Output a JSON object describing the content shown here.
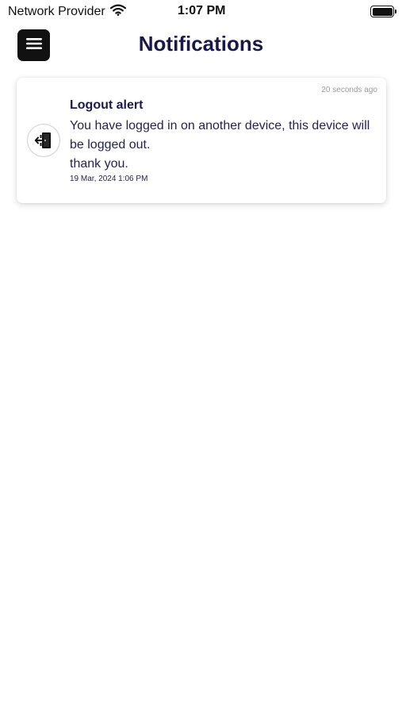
{
  "status_bar": {
    "carrier": "Network Provider",
    "time": "1:07 PM"
  },
  "header": {
    "title": "Notifications",
    "menu_icon": "hamburger-menu-icon"
  },
  "notifications": [
    {
      "relative_time": "20 seconds ago",
      "title": "Logout alert",
      "message": "You have logged in on another device, this device will be logged out.\nthank you.",
      "timestamp": "19 Mar, 2024 1:06 PM",
      "icon": "logout-door-icon"
    }
  ]
}
